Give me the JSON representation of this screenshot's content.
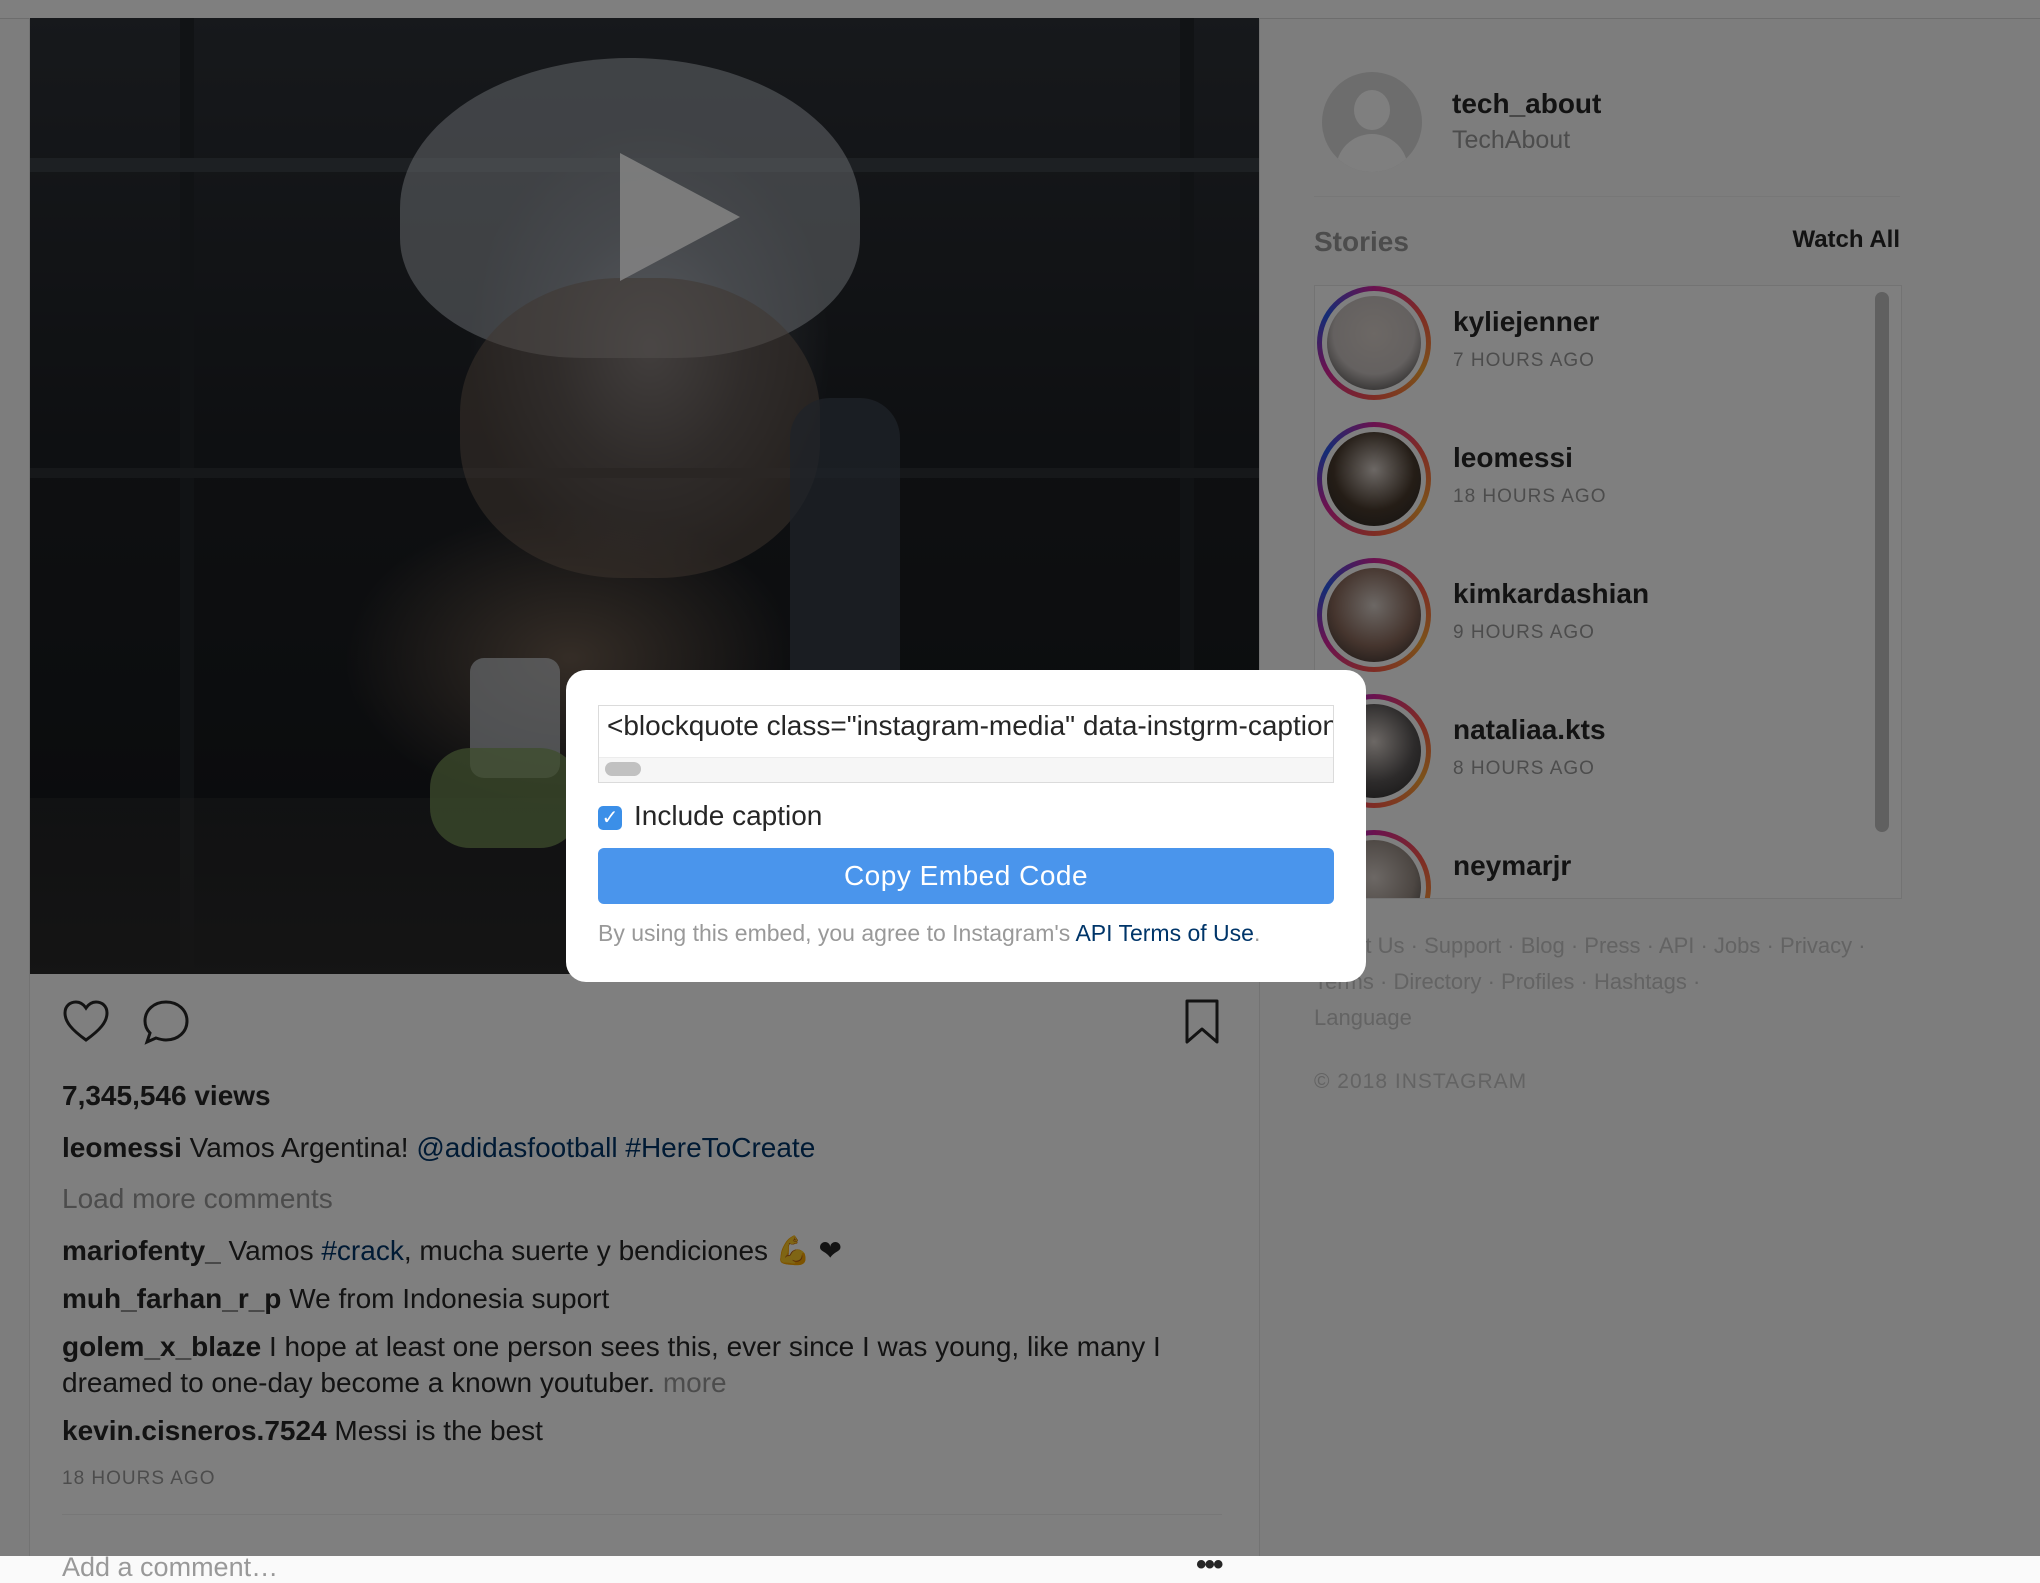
{
  "post": {
    "views": "7,345,546 views",
    "caption": {
      "username": "leomessi",
      "text": "Vamos Argentina!",
      "mention": "@adidasfootball",
      "hashtag": "#HereToCreate"
    },
    "load_more": "Load more comments",
    "comments": [
      {
        "username": "mariofenty_",
        "pre": "Vamos ",
        "hashtag": "#crack",
        "post": ", mucha suerte y bendiciones 💪 ❤"
      },
      {
        "username": "muh_farhan_r_p",
        "text": "We from Indonesia suport"
      },
      {
        "username": "golem_x_blaze",
        "text": "I hope at least one person sees this, ever since I was young, like many I dreamed to one-day become a known youtuber.",
        "more": "more"
      },
      {
        "username": "kevin.cisneros.7524",
        "text": "Messi is the best"
      }
    ],
    "timestamp": "18 HOURS AGO",
    "add_comment_placeholder": "Add a comment…",
    "more_options": "•••"
  },
  "sidebar": {
    "profile": {
      "username": "tech_about",
      "name": "TechAbout"
    },
    "stories_title": "Stories",
    "watch_all": "Watch All",
    "stories": [
      {
        "username": "kyliejenner",
        "time": "7 HOURS AGO",
        "color": "#c9c2c0"
      },
      {
        "username": "leomessi",
        "time": "18 HOURS AGO",
        "color": "#4a3b2e"
      },
      {
        "username": "kimkardashian",
        "time": "9 HOURS AGO",
        "color": "#8b6a5c"
      },
      {
        "username": "nataliaa.kts",
        "time": "8 HOURS AGO",
        "color": "#5a5656"
      },
      {
        "username": "neymarjr",
        "time": "",
        "color": "#9a8e86"
      }
    ],
    "footer_links": [
      "About Us",
      "Support",
      "Blog",
      "Press",
      "API",
      "Jobs",
      "Privacy",
      "Terms",
      "Directory",
      "Profiles",
      "Hashtags",
      "Language"
    ],
    "copyright": "© 2018 INSTAGRAM"
  },
  "modal": {
    "embed_code": "<blockquote class=\"instagram-media\" data-instgrm-captioned data-instgrm-permalink=",
    "include_caption_label": "Include caption",
    "include_caption_checked": true,
    "copy_button": "Copy Embed Code",
    "terms_text": "By using this embed, you agree to Instagram's ",
    "terms_link": "API Terms of Use",
    "terms_end": "."
  },
  "colors": {
    "accent": "#4a95ec",
    "link": "#003569",
    "overlay": "rgba(0,0,0,0.5)"
  }
}
